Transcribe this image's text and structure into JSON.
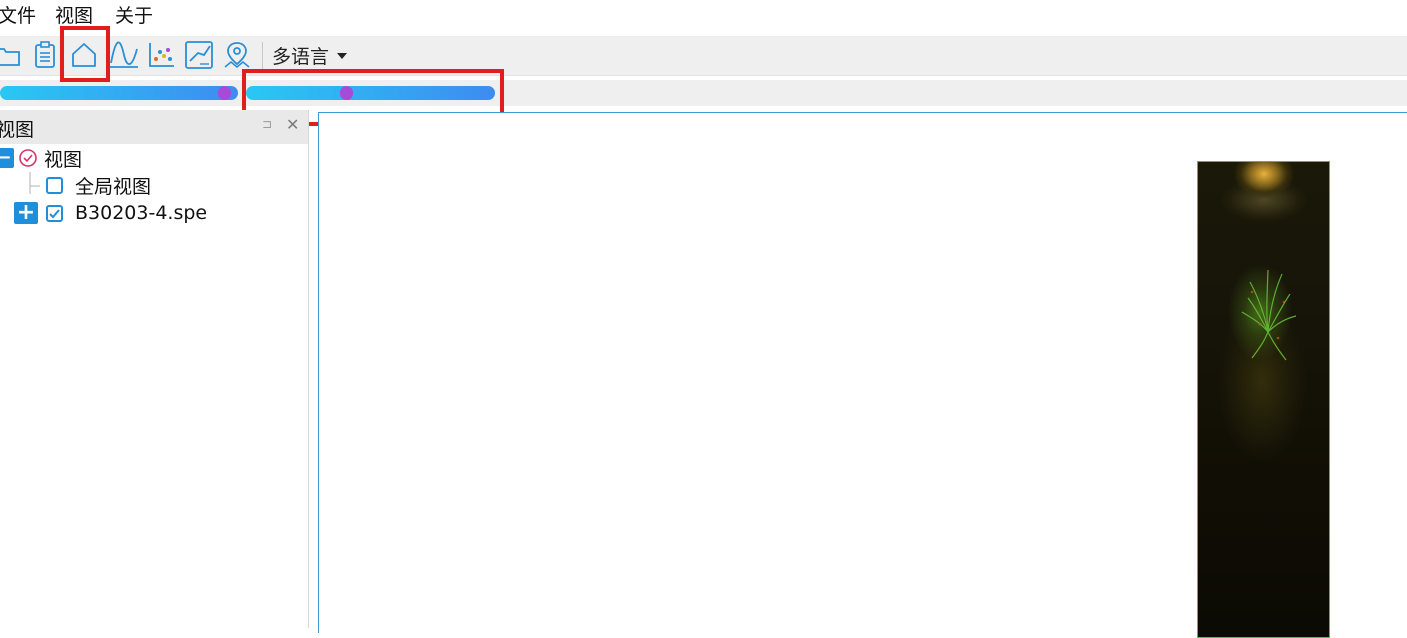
{
  "menu": {
    "file": "文件",
    "view": "视图",
    "about": "关于"
  },
  "toolbar": {
    "icons": [
      "open-folder-icon",
      "clipboard-icon",
      "home-icon",
      "curve-icon",
      "scatter-chart-icon",
      "line-chart-icon",
      "map-pin-icon"
    ],
    "language_label": "多语言"
  },
  "sliders": {
    "left_thumb_fraction": 0.97,
    "right_thumb_fraction": 0.4,
    "gradient_start": "#29c8f3",
    "gradient_end": "#3d8cf0",
    "thumb_color": "#a74ad8"
  },
  "panel": {
    "title": "视图",
    "tree": {
      "root_label": "视图",
      "global_view_label": "全局视图",
      "file_label": "B30203-4.spe",
      "global_view_checked": false,
      "file_checked": true
    }
  },
  "colors": {
    "highlight": "#e01e1e",
    "accent": "#1f8fdb",
    "image_border": "#2bd52b"
  }
}
